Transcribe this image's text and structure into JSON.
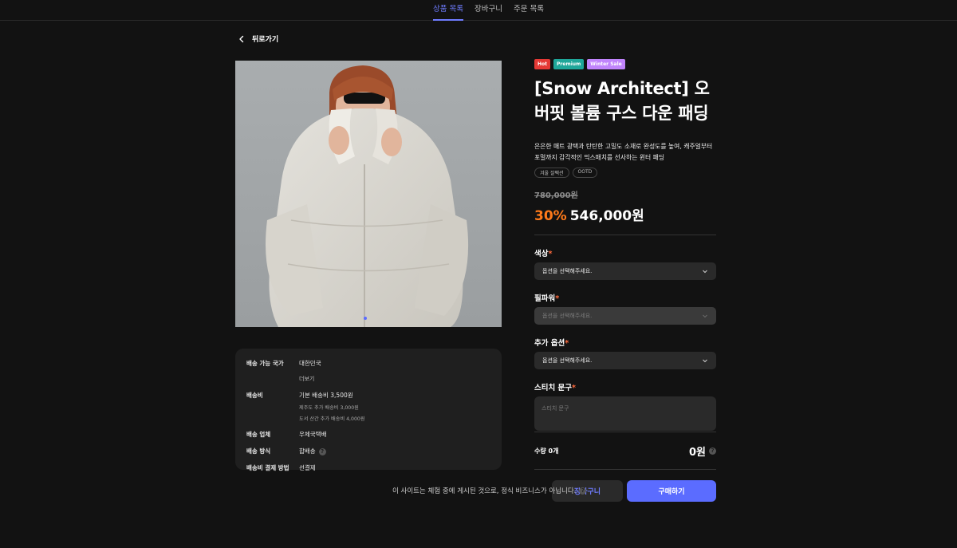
{
  "nav": {
    "tabs": [
      "상품 목록",
      "장바구니",
      "주문 목록"
    ],
    "active_index": 0
  },
  "back_label": "뒤로가기",
  "product": {
    "badges": [
      {
        "label": "Hot",
        "color": "#e53935"
      },
      {
        "label": "Premium",
        "color": "#1fa79a"
      },
      {
        "label": "Winter Sale",
        "color": "#c084fc"
      }
    ],
    "title": "[Snow Architect] 오버핏 볼륨 구스 다운 패딩",
    "description": "은은한 매트 광택과 탄탄한 고밀도 소재로 완성도를 높여, 캐주얼부터 포멀까지 감각적인 믹스매치를 선사하는 윈터 패딩",
    "tags": [
      "겨울 잘팩션",
      "OOTD"
    ],
    "original_price": "780,000원",
    "discount": "30%",
    "price": "546,000원",
    "accent_color": "#ff7a1a"
  },
  "options": [
    {
      "label": "색상",
      "placeholder": "옵션을 선택해주세요.",
      "disabled": false
    },
    {
      "label": "필파워",
      "placeholder": "옵션을 선택해주세요.",
      "disabled": true
    },
    {
      "label": "추가 옵션",
      "placeholder": "옵션을 선택해주세요.",
      "disabled": false
    }
  ],
  "stitch": {
    "label": "스티치 문구",
    "placeholder": "스티치 문구"
  },
  "required_mark": "*",
  "shipping": {
    "country_label": "배송 가능 국가",
    "country_value": "대한민국",
    "more": "더보기",
    "fee_label": "배송비",
    "fee_value": "기본 배송비 3,500원",
    "fee_sub1": "제주도 추가 배송비 3,000원",
    "fee_sub2": "도서 산간 추가 배송비 4,000원",
    "company_label": "배송 업체",
    "company_value": "우체국택배",
    "method_label": "배송 방식",
    "method_value": "합배송",
    "payment_label": "배송비 결제 방법",
    "payment_value": "선결제"
  },
  "quantity": {
    "label": "수량 0개",
    "total": "0원"
  },
  "buttons": {
    "cart": "장바구니",
    "buy": "구매하기"
  },
  "notice": "이 사이트는 체험 중에 게시된 것으로, 정식 비즈니스가 아닙니다.",
  "brand_color": "#5b6cff"
}
